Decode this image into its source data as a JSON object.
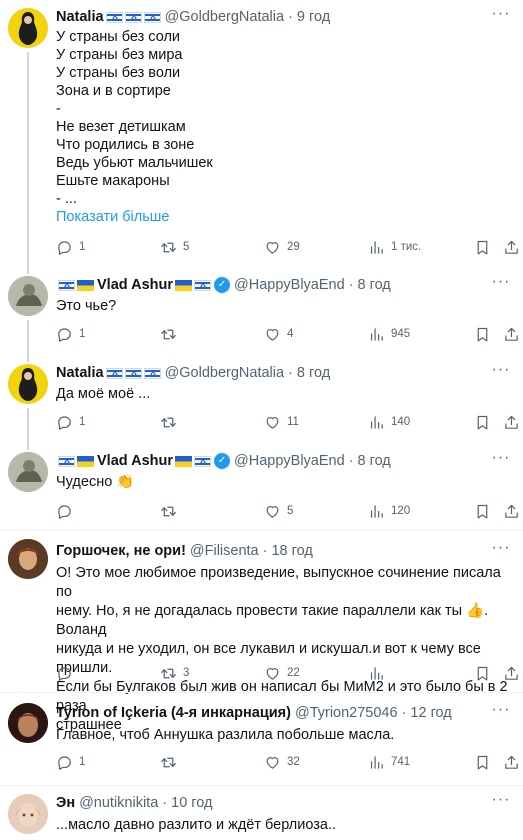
{
  "tweets": [
    {
      "name": "Natalia",
      "handle": "@GoldbergNatalia",
      "time": "9 год",
      "lines": [
        "У страны без соли",
        "У страны без мира",
        "У страны без воли",
        "Зона и в сортире",
        "-",
        "Не везет детишкам",
        "Что родились в зоне",
        "Ведь убьют мальчишек",
        "Ешьте макароны",
        "- ..."
      ],
      "show_more": "Показати більше",
      "replies": "1",
      "retweets": "5",
      "likes": "29",
      "views": "1 тис."
    },
    {
      "name": "Vlad Ashur",
      "handle": "@HappyBlyaEnd",
      "time": "8 год",
      "text": "Это чье?",
      "replies": "1",
      "retweets": "",
      "likes": "4",
      "views": "945"
    },
    {
      "name": "Natalia",
      "handle": "@GoldbergNatalia",
      "time": "8 год",
      "text": "Да моё моё ...",
      "replies": "1",
      "retweets": "",
      "likes": "11",
      "views": "140"
    },
    {
      "name": "Vlad Ashur",
      "handle": "@HappyBlyaEnd",
      "time": "8 год",
      "text": "Чудесно 👏",
      "replies": "",
      "retweets": "",
      "likes": "5",
      "views": "120"
    },
    {
      "name": "Горшочек, не ори!",
      "handle": "@Filisenta",
      "time": "18 год",
      "lines": [
        "О! Это мое любимое произведение, выпускное сочинение писала по",
        "нему. Но, я не догадалась провести такие параллели как ты 👍. Воланд",
        "никуда и не уходил, он все лукавил и искушал.и вот к чему все пришли.",
        "Если бы Булгаков был жив он написал бы МиМ2 и это было бы в 2 раза",
        "страшнее"
      ],
      "replies": "",
      "retweets": "3",
      "likes": "22",
      "views": ""
    },
    {
      "name": "Tyrion of Içkeria (4-я инкарнация)",
      "handle": "@Tyrion275046",
      "time": "12 год",
      "text": "Главное, чтоб Аннушка разлила побольше масла.",
      "replies": "1",
      "retweets": "",
      "likes": "32",
      "views": "741"
    },
    {
      "name": "Эн",
      "handle": "@nutiknikita",
      "time": "10 год",
      "text": "...масло давно разлито и ждёт берлиоза.."
    }
  ],
  "icons": {
    "reply": "reply-icon",
    "retweet": "retweet-icon",
    "like": "heart-icon",
    "views": "views-icon",
    "bookmark": "bookmark-icon",
    "share": "share-icon",
    "more": "more-icon",
    "verified": "verified-badge-icon"
  },
  "colors": {
    "link": "#1d9bf0",
    "muted": "#536471",
    "text": "#0f1419",
    "divider": "#eff3f4",
    "thread": "#cfd9de"
  }
}
